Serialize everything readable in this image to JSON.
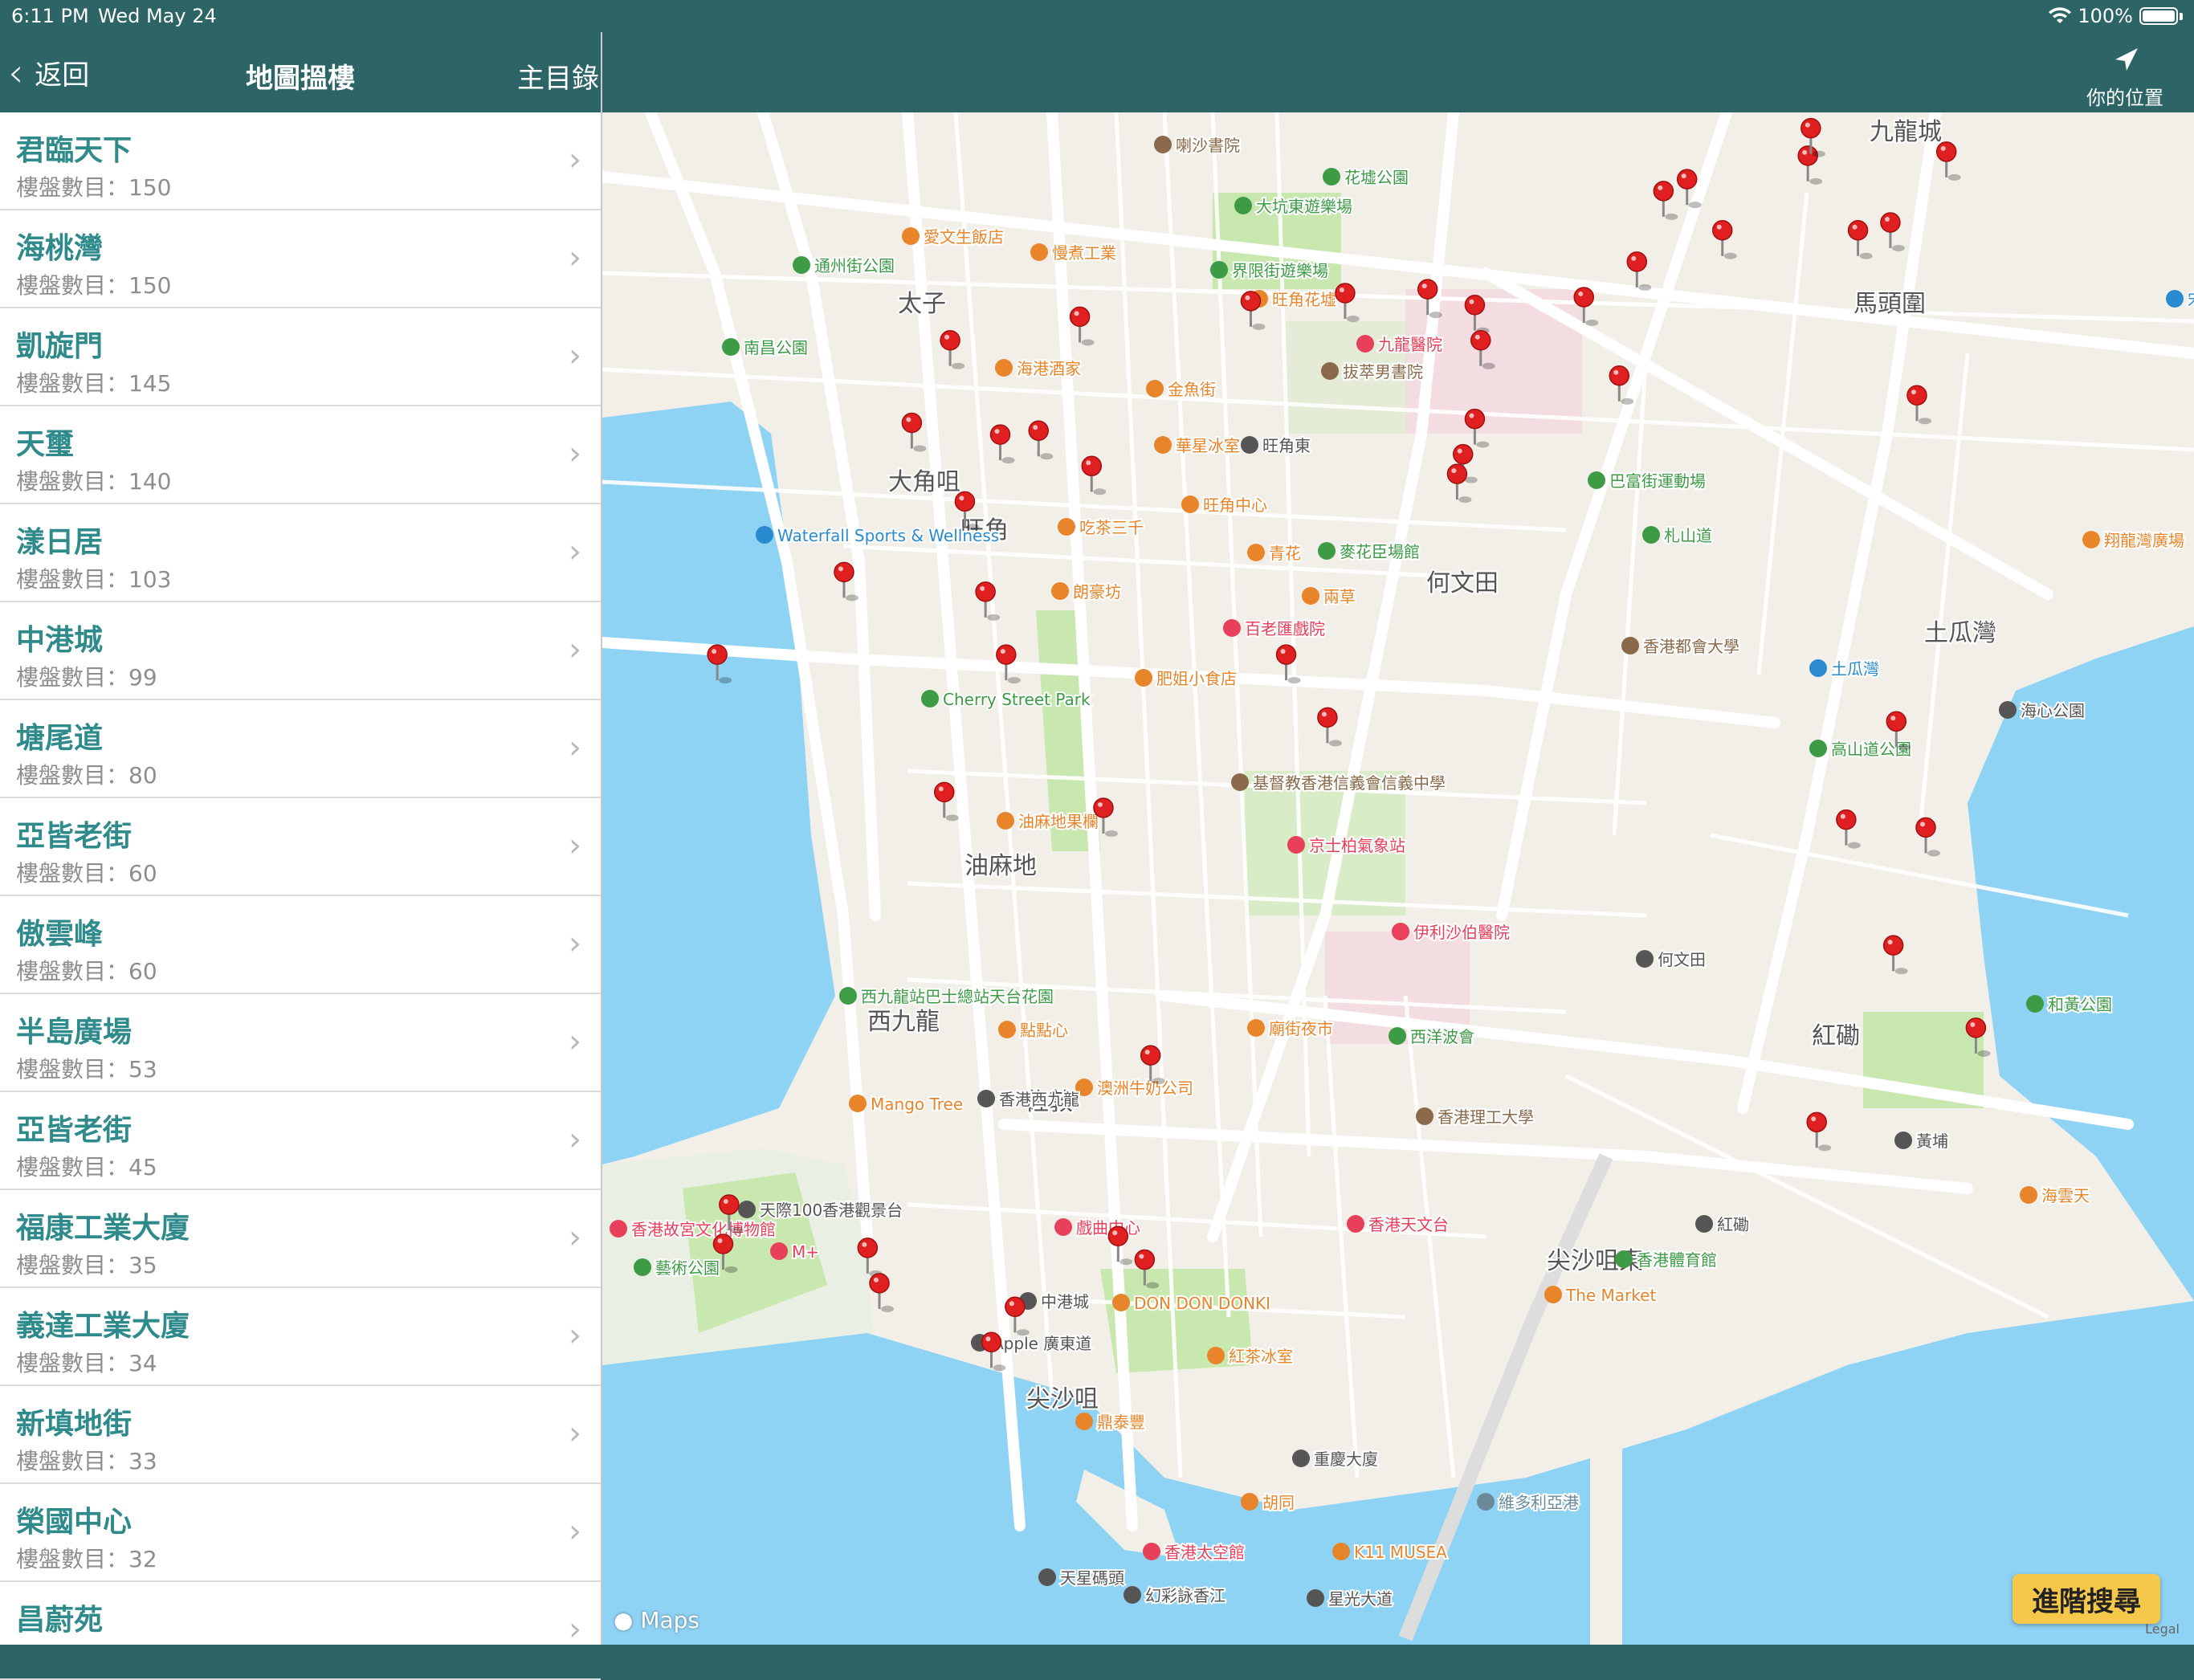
{
  "status": {
    "time": "6:11 PM",
    "date": "Wed May 24",
    "battery": "100%"
  },
  "sidebar": {
    "back_label": "返回",
    "title": "地圖搵樓",
    "main_menu_label": "主目錄",
    "items": [
      {
        "name": "君臨天下",
        "count": "樓盤數目：150"
      },
      {
        "name": "海桃灣",
        "count": "樓盤數目：150"
      },
      {
        "name": "凱旋門",
        "count": "樓盤數目：145"
      },
      {
        "name": "天璽",
        "count": "樓盤數目：140"
      },
      {
        "name": "漾日居",
        "count": "樓盤數目：103"
      },
      {
        "name": "中港城",
        "count": "樓盤數目：99"
      },
      {
        "name": "塘尾道",
        "count": "樓盤數目：80"
      },
      {
        "name": "亞皆老街",
        "count": "樓盤數目：60"
      },
      {
        "name": "傲雲峰",
        "count": "樓盤數目：60"
      },
      {
        "name": "半島廣場",
        "count": "樓盤數目：53"
      },
      {
        "name": "亞皆老街",
        "count": "樓盤數目：45"
      },
      {
        "name": "福康工業大廈",
        "count": "樓盤數目：35"
      },
      {
        "name": "義達工業大廈",
        "count": "樓盤數目：34"
      },
      {
        "name": "新填地街",
        "count": "樓盤數目：33"
      },
      {
        "name": "榮國中心",
        "count": "樓盤數目：32"
      },
      {
        "name": "昌蔚苑",
        "count": ""
      }
    ]
  },
  "map": {
    "locate_label": "你的位置",
    "advanced_search_label": "進階搜尋",
    "attribution": "Maps",
    "legal": "Legal",
    "colors": {
      "water": "#8fd3f4",
      "land": "#f2efe9",
      "park": "#c9e8b0",
      "pin": "#e02020",
      "header": "#2d6466"
    },
    "districts": [
      "太子",
      "大角咀",
      "旺角",
      "何文田",
      "油麻地",
      "西九龍",
      "佐敦",
      "尖沙咀東",
      "尖沙咀",
      "紅磡",
      "土瓜灣",
      "馬頭圍",
      "九龍城"
    ],
    "pois": [
      {
        "text": "花墟公園",
        "color": "#3d9b46"
      },
      {
        "text": "大坑東遊樂場",
        "color": "#3d9b46"
      },
      {
        "text": "愛文生飯店",
        "color": "#e8852a"
      },
      {
        "text": "慢煮工業",
        "color": "#e8852a"
      },
      {
        "text": "通州街公園",
        "color": "#3d9b46"
      },
      {
        "text": "界限街遊樂場",
        "color": "#3d9b46"
      },
      {
        "text": "旺角花墟",
        "color": "#e8852a"
      },
      {
        "text": "南昌公園",
        "color": "#3d9b46"
      },
      {
        "text": "海港酒家",
        "color": "#e8852a"
      },
      {
        "text": "金魚街",
        "color": "#e8852a"
      },
      {
        "text": "拔萃男書院",
        "color": "#8a6a4a"
      },
      {
        "text": "九龍醫院",
        "color": "#e8405a"
      },
      {
        "text": "華星冰室",
        "color": "#e8852a"
      },
      {
        "text": "旺角東",
        "color": "#555555"
      },
      {
        "text": "巴富街運動場",
        "color": "#3d9b46"
      },
      {
        "text": "Waterfall Sports & Wellness",
        "color": "#2a8ad0"
      },
      {
        "text": "旺角中心",
        "color": "#e8852a"
      },
      {
        "text": "吃茶三千",
        "color": "#e8852a"
      },
      {
        "text": "青花",
        "color": "#e8852a"
      },
      {
        "text": "麥花臣場館",
        "color": "#3d9b46"
      },
      {
        "text": "札山道",
        "color": "#3d9b46"
      },
      {
        "text": "翔龍灣廣場",
        "color": "#e8852a"
      },
      {
        "text": "朗豪坊",
        "color": "#e8852a"
      },
      {
        "text": "兩草",
        "color": "#e8852a"
      },
      {
        "text": "百老匯戲院",
        "color": "#e8405a"
      },
      {
        "text": "香港都會大學",
        "color": "#8a6a4a"
      },
      {
        "text": "土瓜灣",
        "color": "#2a8ad0"
      },
      {
        "text": "海心公園",
        "color": "#555555"
      },
      {
        "text": "肥姐小食店",
        "color": "#e8852a"
      },
      {
        "text": "Cherry Street Park",
        "color": "#3d9b46"
      },
      {
        "text": "高山道公園",
        "color": "#3d9b46"
      },
      {
        "text": "基督教香港信義會信義中學",
        "color": "#8a6a4a"
      },
      {
        "text": "油麻地果欄",
        "color": "#e8852a"
      },
      {
        "text": "京士柏氣象站",
        "color": "#e8405a"
      },
      {
        "text": "伊利沙伯醫院",
        "color": "#e8405a"
      },
      {
        "text": "何文田",
        "color": "#555555"
      },
      {
        "text": "西九龍站巴士總站天台花園",
        "color": "#3d9b46"
      },
      {
        "text": "和黃公園",
        "color": "#3d9b46"
      },
      {
        "text": "點點心",
        "color": "#e8852a"
      },
      {
        "text": "廟街夜市",
        "color": "#e8852a"
      },
      {
        "text": "西洋波會",
        "color": "#3d9b46"
      },
      {
        "text": "澳洲牛奶公司",
        "color": "#e8852a"
      },
      {
        "text": "Mango Tree",
        "color": "#e8852a"
      },
      {
        "text": "香港西九龍",
        "color": "#555555"
      },
      {
        "text": "香港理工大學",
        "color": "#8a6a4a"
      },
      {
        "text": "黃埔",
        "color": "#555555"
      },
      {
        "text": "海雲天",
        "color": "#e8852a"
      },
      {
        "text": "天際100香港觀景台",
        "color": "#555555"
      },
      {
        "text": "戲曲中心",
        "color": "#e8405a"
      },
      {
        "text": "香港天文台",
        "color": "#e8405a"
      },
      {
        "text": "紅磡",
        "color": "#555555"
      },
      {
        "text": "香港故宮文化博物館",
        "color": "#e8405a"
      },
      {
        "text": "M+",
        "color": "#e8405a"
      },
      {
        "text": "香港體育館",
        "color": "#3d9b46"
      },
      {
        "text": "藝術公園",
        "color": "#3d9b46"
      },
      {
        "text": "中港城",
        "color": "#555555"
      },
      {
        "text": "DON DON DONKI",
        "color": "#e8852a"
      },
      {
        "text": "The Market",
        "color": "#e8852a"
      },
      {
        "text": "Apple 廣東道",
        "color": "#555555"
      },
      {
        "text": "紅茶冰室",
        "color": "#e8852a"
      },
      {
        "text": "鼎泰豐",
        "color": "#e8852a"
      },
      {
        "text": "重慶大廈",
        "color": "#555555"
      },
      {
        "text": "胡同",
        "color": "#e8852a"
      },
      {
        "text": "K11 MUSEA",
        "color": "#e8852a"
      },
      {
        "text": "香港太空館",
        "color": "#e8405a"
      },
      {
        "text": "天星碼頭",
        "color": "#555555"
      },
      {
        "text": "幻彩詠香江",
        "color": "#555555"
      },
      {
        "text": "星光大道",
        "color": "#555555"
      },
      {
        "text": "維多利亞港",
        "color": "#6a8a9a"
      },
      {
        "text": "宋皇臺",
        "color": "#2a8ad0"
      },
      {
        "text": "喇沙書院",
        "color": "#8a6a4a"
      }
    ],
    "pins": [
      {
        "lng": 114.1708,
        "lat": 22.3262
      },
      {
        "lng": 114.1752,
        "lat": 22.3268
      },
      {
        "lng": 114.1695,
        "lat": 22.3241
      },
      {
        "lng": 114.1725,
        "lat": 22.3238
      },
      {
        "lng": 114.1738,
        "lat": 22.3239
      },
      {
        "lng": 114.1756,
        "lat": 22.323
      },
      {
        "lng": 114.1713,
        "lat": 22.3221
      },
      {
        "lng": 114.1672,
        "lat": 22.3203
      },
      {
        "lng": 114.1629,
        "lat": 22.3182
      },
      {
        "lng": 114.172,
        "lat": 22.3198
      },
      {
        "lng": 114.1727,
        "lat": 22.3182
      },
      {
        "lng": 114.1706,
        "lat": 22.3147
      },
      {
        "lng": 114.176,
        "lat": 22.3143
      },
      {
        "lng": 114.1776,
        "lat": 22.308
      },
      {
        "lng": 114.1633,
        "lat": 22.3042
      },
      {
        "lng": 114.168,
        "lat": 22.3031
      },
      {
        "lng": 114.1684,
        "lat": 22.3022
      },
      {
        "lng": 114.1631,
        "lat": 22.3032
      },
      {
        "lng": 114.1765,
        "lat": 22.3034
      },
      {
        "lng": 114.1774,
        "lat": 22.3028
      },
      {
        "lng": 114.173,
        "lat": 22.3016
      },
      {
        "lng": 114.1722,
        "lat": 22.3007
      },
      {
        "lng": 114.1842,
        "lat": 22.3274
      },
      {
        "lng": 114.187,
        "lat": 22.3275
      },
      {
        "lng": 114.1886,
        "lat": 22.3271
      },
      {
        "lng": 114.1888,
        "lat": 22.3262
      },
      {
        "lng": 114.1923,
        "lat": 22.3273
      },
      {
        "lng": 114.1941,
        "lat": 22.3282
      },
      {
        "lng": 114.195,
        "lat": 22.33
      },
      {
        "lng": 114.1958,
        "lat": 22.3303
      },
      {
        "lng": 114.197,
        "lat": 22.329
      },
      {
        "lng": 114.1999,
        "lat": 22.3309
      },
      {
        "lng": 114.2,
        "lat": 22.3316
      },
      {
        "lng": 114.2016,
        "lat": 22.329
      },
      {
        "lng": 114.2027,
        "lat": 22.3292
      },
      {
        "lng": 114.2046,
        "lat": 22.331
      },
      {
        "lng": 114.1935,
        "lat": 22.3253
      },
      {
        "lng": 114.2036,
        "lat": 22.3248
      },
      {
        "lng": 114.1886,
        "lat": 22.3242
      },
      {
        "lng": 114.1882,
        "lat": 22.3233
      },
      {
        "lng": 114.188,
        "lat": 22.3228
      },
      {
        "lng": 114.1822,
        "lat": 22.3182
      },
      {
        "lng": 114.1836,
        "lat": 22.3166
      },
      {
        "lng": 114.2029,
        "lat": 22.3165
      },
      {
        "lng": 114.2012,
        "lat": 22.314
      },
      {
        "lng": 114.2039,
        "lat": 22.3138
      },
      {
        "lng": 114.2028,
        "lat": 22.3108
      },
      {
        "lng": 114.2056,
        "lat": 22.3087
      },
      {
        "lng": 114.2002,
        "lat": 22.3063
      },
      {
        "lng": 114.181,
        "lat": 22.3272
      }
    ]
  }
}
